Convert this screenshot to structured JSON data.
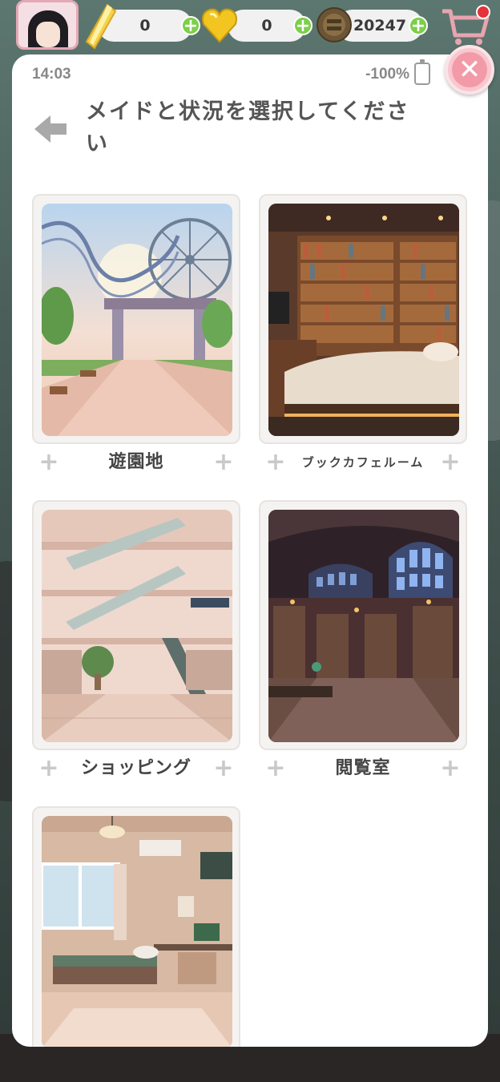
{
  "currency": {
    "crystal": {
      "value": "0",
      "icon": "crystal-icon"
    },
    "gem": {
      "value": "0",
      "icon": "heart-gem-icon"
    },
    "coin": {
      "value": "20247",
      "icon": "coin-icon"
    },
    "plus": "+"
  },
  "status": {
    "time": "14:03",
    "battery": "-100%"
  },
  "modal": {
    "title": "メイドと状況を選択してください",
    "close_icon": "close-icon",
    "back_icon": "back-arrow-icon",
    "close_glyph": "✕"
  },
  "scenes": [
    {
      "label": "遊園地",
      "image": "amusement-park"
    },
    {
      "label": "ブックカフェルーム",
      "image": "book-cafe-room"
    },
    {
      "label": "ショッピング",
      "image": "shopping-mall"
    },
    {
      "label": "閲覧室",
      "image": "reading-room"
    },
    {
      "label": "",
      "image": "bedroom"
    }
  ],
  "colors": {
    "accent_pink": "#f39aa8",
    "plus_green": "#7ccf4a",
    "title_gray": "#555555"
  }
}
